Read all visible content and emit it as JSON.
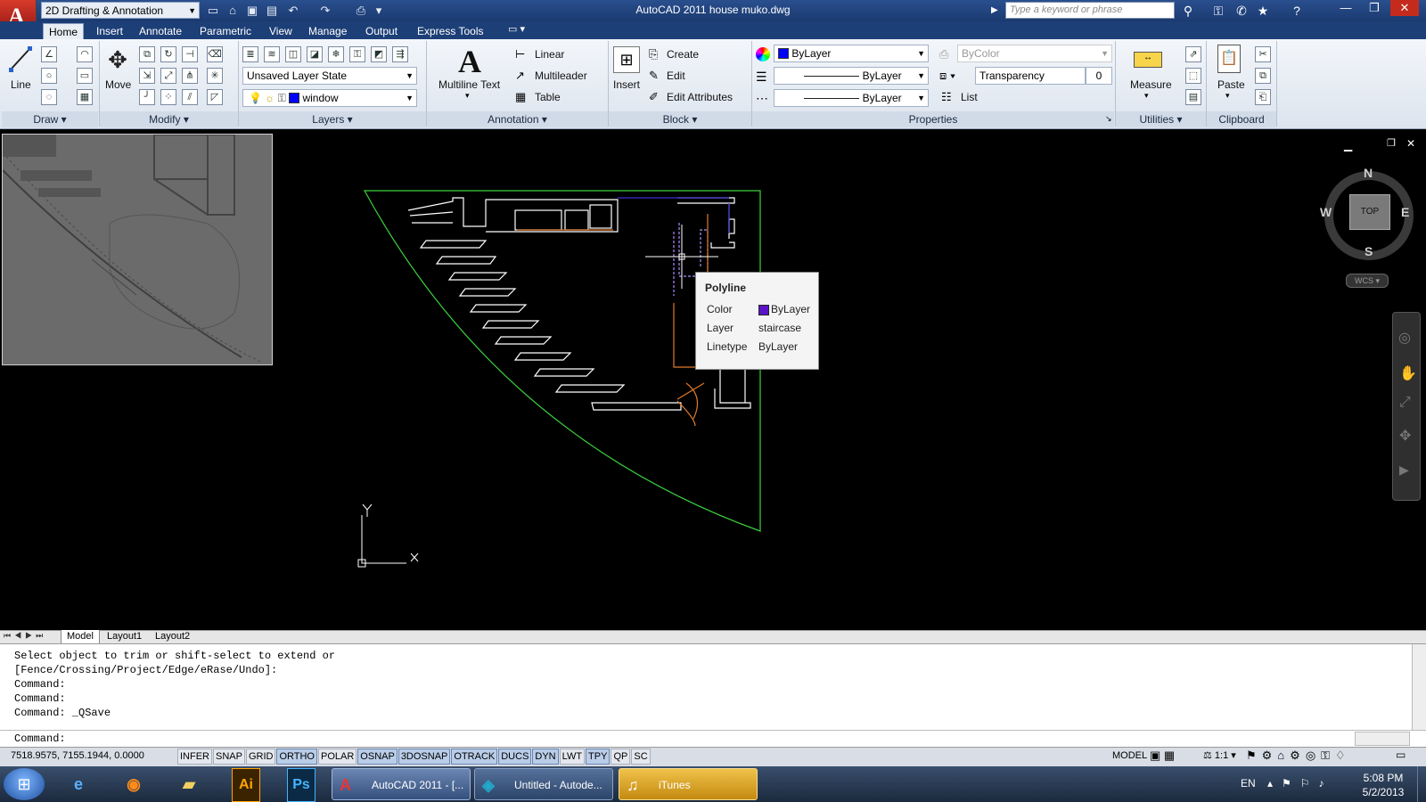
{
  "titlebar": {
    "app_letter": "A",
    "workspace": "2D Drafting & Annotation",
    "title": "AutoCAD 2011    house muko.dwg",
    "search_placeholder": "Type a keyword or phrase",
    "minimize": "—",
    "restore": "❐",
    "close": "✕"
  },
  "tabs": [
    "Home",
    "Insert",
    "Annotate",
    "Parametric",
    "View",
    "Manage",
    "Output",
    "Express Tools"
  ],
  "panels": {
    "draw": {
      "title": "Draw",
      "line_label": "Line"
    },
    "modify": {
      "title": "Modify",
      "move_label": "Move"
    },
    "layers": {
      "title": "Layers",
      "layer_state": "Unsaved Layer State",
      "current_layer": "window"
    },
    "annotation": {
      "title": "Annotation",
      "mtext_label": "Multiline Text",
      "linear": "Linear",
      "multileader": "Multileader",
      "table": "Table"
    },
    "block": {
      "title": "Block",
      "insert_label": "Insert",
      "create": "Create",
      "edit": "Edit",
      "edit_attributes": "Edit Attributes"
    },
    "properties": {
      "title": "Properties",
      "color": "ByLayer",
      "plot_style": "ByColor",
      "lineweight": "ByLayer",
      "linetype": "ByLayer",
      "transparency_label": "Transparency",
      "transparency_value": "0",
      "list": "List"
    },
    "utilities": {
      "title": "Utilities",
      "measure": "Measure"
    },
    "clipboard": {
      "title": "Clipboard",
      "paste": "Paste"
    }
  },
  "viewcube": {
    "n": "N",
    "s": "S",
    "e": "E",
    "w": "W",
    "top": "TOP",
    "ucs": "WCS"
  },
  "ucs_icon": {
    "x": "X",
    "y": "Y"
  },
  "tooltip": {
    "title": "Polyline",
    "rows": [
      {
        "label": "Color",
        "value": "ByLayer"
      },
      {
        "label": "Layer",
        "value": "staircase"
      },
      {
        "label": "Linetype",
        "value": "ByLayer"
      }
    ]
  },
  "layout_tabs": [
    "Model",
    "Layout1",
    "Layout2"
  ],
  "command_history": [
    "Select object to trim or shift-select to extend or",
    "[Fence/Crossing/Project/Edge/eRase/Undo]:",
    "Command:",
    "Command:",
    "Command: _QSave"
  ],
  "command_prompt": "Command:",
  "status": {
    "coords": "7518.9575, 7155.1944, 0.0000",
    "toggles": [
      {
        "label": "INFER",
        "on": false
      },
      {
        "label": "SNAP",
        "on": false
      },
      {
        "label": "GRID",
        "on": false
      },
      {
        "label": "ORTHO",
        "on": true
      },
      {
        "label": "POLAR",
        "on": false
      },
      {
        "label": "OSNAP",
        "on": true
      },
      {
        "label": "3DOSNAP",
        "on": true
      },
      {
        "label": "OTRACK",
        "on": true
      },
      {
        "label": "DUCS",
        "on": true
      },
      {
        "label": "DYN",
        "on": true
      },
      {
        "label": "LWT",
        "on": false
      },
      {
        "label": "TPY",
        "on": true
      },
      {
        "label": "QP",
        "on": false
      },
      {
        "label": "SC",
        "on": false
      }
    ],
    "space": "MODEL",
    "scale": "1:1"
  },
  "taskbar": {
    "tasks": [
      "AutoCAD 2011 - [...",
      "Untitled - Autode...",
      "iTunes"
    ],
    "ai_label": "Ai",
    "ps_label": "Ps",
    "lang": "EN",
    "time": "5:08 PM",
    "date": "5/2/2013"
  }
}
